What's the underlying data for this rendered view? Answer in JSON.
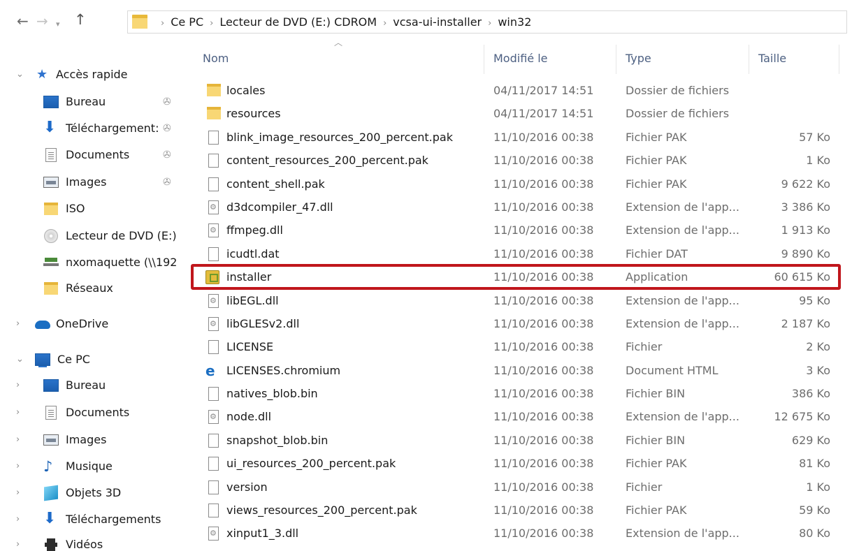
{
  "address_bar": {
    "crumbs": [
      "Ce PC",
      "Lecteur de DVD (E:) CDROM",
      "vcsa-ui-installer",
      "win32"
    ]
  },
  "sidebar": {
    "quick_access": "Accès rapide",
    "quick_items": [
      {
        "label": "Bureau",
        "icon": "desktop-icon"
      },
      {
        "label": "Téléchargement:",
        "icon": "download-icon"
      },
      {
        "label": "Documents",
        "icon": "documents-icon"
      },
      {
        "label": "Images",
        "icon": "images-icon"
      },
      {
        "label": "ISO",
        "icon": "folder-icon"
      },
      {
        "label": "Lecteur de DVD (E:)",
        "icon": "dvd-icon"
      },
      {
        "label": "nxomaquette (\\\\192",
        "icon": "network-drive-icon"
      },
      {
        "label": "Réseaux",
        "icon": "folder-icon"
      }
    ],
    "onedrive": "OneDrive",
    "this_pc": "Ce PC",
    "pc_items": [
      {
        "label": "Bureau",
        "icon": "desktop-icon"
      },
      {
        "label": "Documents",
        "icon": "documents-icon"
      },
      {
        "label": "Images",
        "icon": "images-icon"
      },
      {
        "label": "Musique",
        "icon": "music-icon"
      },
      {
        "label": "Objets 3D",
        "icon": "3d-objects-icon"
      },
      {
        "label": "Téléchargements",
        "icon": "download-icon"
      },
      {
        "label": "Vidéos",
        "icon": "videos-icon"
      }
    ]
  },
  "columns": {
    "name": "Nom",
    "modified": "Modifié le",
    "type": "Type",
    "size": "Taille"
  },
  "files": [
    {
      "name": "locales",
      "date": "04/11/2017 14:51",
      "type": "Dossier de fichiers",
      "size": "",
      "kind": "folder"
    },
    {
      "name": "resources",
      "date": "04/11/2017 14:51",
      "type": "Dossier de fichiers",
      "size": "",
      "kind": "folder"
    },
    {
      "name": "blink_image_resources_200_percent.pak",
      "date": "11/10/2016 00:38",
      "type": "Fichier PAK",
      "size": "57 Ko",
      "kind": "file"
    },
    {
      "name": "content_resources_200_percent.pak",
      "date": "11/10/2016 00:38",
      "type": "Fichier PAK",
      "size": "1 Ko",
      "kind": "file"
    },
    {
      "name": "content_shell.pak",
      "date": "11/10/2016 00:38",
      "type": "Fichier PAK",
      "size": "9 622 Ko",
      "kind": "file"
    },
    {
      "name": "d3dcompiler_47.dll",
      "date": "11/10/2016 00:38",
      "type": "Extension de l'app...",
      "size": "3 386 Ko",
      "kind": "dll"
    },
    {
      "name": "ffmpeg.dll",
      "date": "11/10/2016 00:38",
      "type": "Extension de l'app...",
      "size": "1 913 Ko",
      "kind": "dll"
    },
    {
      "name": "icudtl.dat",
      "date": "11/10/2016 00:38",
      "type": "Fichier DAT",
      "size": "9 890 Ko",
      "kind": "file"
    },
    {
      "name": "installer",
      "date": "11/10/2016 00:38",
      "type": "Application",
      "size": "60 615 Ko",
      "kind": "app"
    },
    {
      "name": "libEGL.dll",
      "date": "11/10/2016 00:38",
      "type": "Extension de l'app...",
      "size": "95 Ko",
      "kind": "dll"
    },
    {
      "name": "libGLESv2.dll",
      "date": "11/10/2016 00:38",
      "type": "Extension de l'app...",
      "size": "2 187 Ko",
      "kind": "dll"
    },
    {
      "name": "LICENSE",
      "date": "11/10/2016 00:38",
      "type": "Fichier",
      "size": "2 Ko",
      "kind": "file"
    },
    {
      "name": "LICENSES.chromium",
      "date": "11/10/2016 00:38",
      "type": "Document HTML",
      "size": "3 Ko",
      "kind": "html"
    },
    {
      "name": "natives_blob.bin",
      "date": "11/10/2016 00:38",
      "type": "Fichier BIN",
      "size": "386 Ko",
      "kind": "file"
    },
    {
      "name": "node.dll",
      "date": "11/10/2016 00:38",
      "type": "Extension de l'app...",
      "size": "12 675 Ko",
      "kind": "dll"
    },
    {
      "name": "snapshot_blob.bin",
      "date": "11/10/2016 00:38",
      "type": "Fichier BIN",
      "size": "629 Ko",
      "kind": "file"
    },
    {
      "name": "ui_resources_200_percent.pak",
      "date": "11/10/2016 00:38",
      "type": "Fichier PAK",
      "size": "81 Ko",
      "kind": "file"
    },
    {
      "name": "version",
      "date": "11/10/2016 00:38",
      "type": "Fichier",
      "size": "1 Ko",
      "kind": "file"
    },
    {
      "name": "views_resources_200_percent.pak",
      "date": "11/10/2016 00:38",
      "type": "Fichier PAK",
      "size": "59 Ko",
      "kind": "file"
    },
    {
      "name": "xinput1_3.dll",
      "date": "11/10/2016 00:38",
      "type": "Extension de l'app...",
      "size": "80 Ko",
      "kind": "dll"
    }
  ],
  "highlighted_file": "installer",
  "colors": {
    "highlight": "#c0161c",
    "header_text": "#4d6082",
    "folder": "#f8d775"
  }
}
